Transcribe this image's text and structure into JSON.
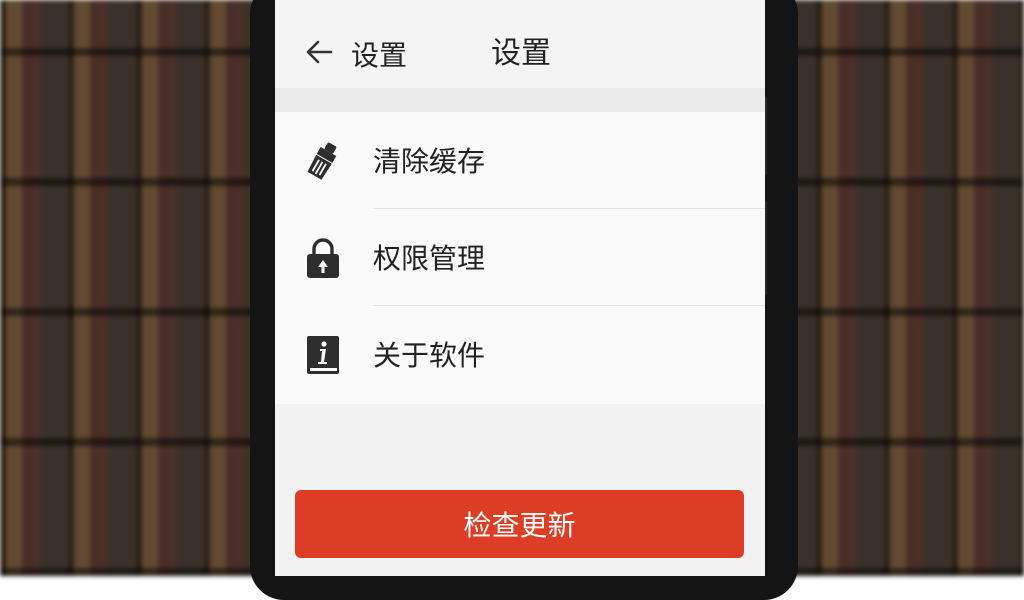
{
  "header": {
    "back_label": "设置",
    "title": "设置"
  },
  "settings_items": [
    {
      "label": "清除缓存",
      "icon": "brush-icon"
    },
    {
      "label": "权限管理",
      "icon": "lock-icon"
    },
    {
      "label": "关于软件",
      "icon": "info-book-icon"
    }
  ],
  "actions": {
    "check_update_label": "检查更新"
  },
  "colors": {
    "accent": "#dc3d24",
    "screen_bg": "#f2f2f2",
    "text": "#222222"
  }
}
